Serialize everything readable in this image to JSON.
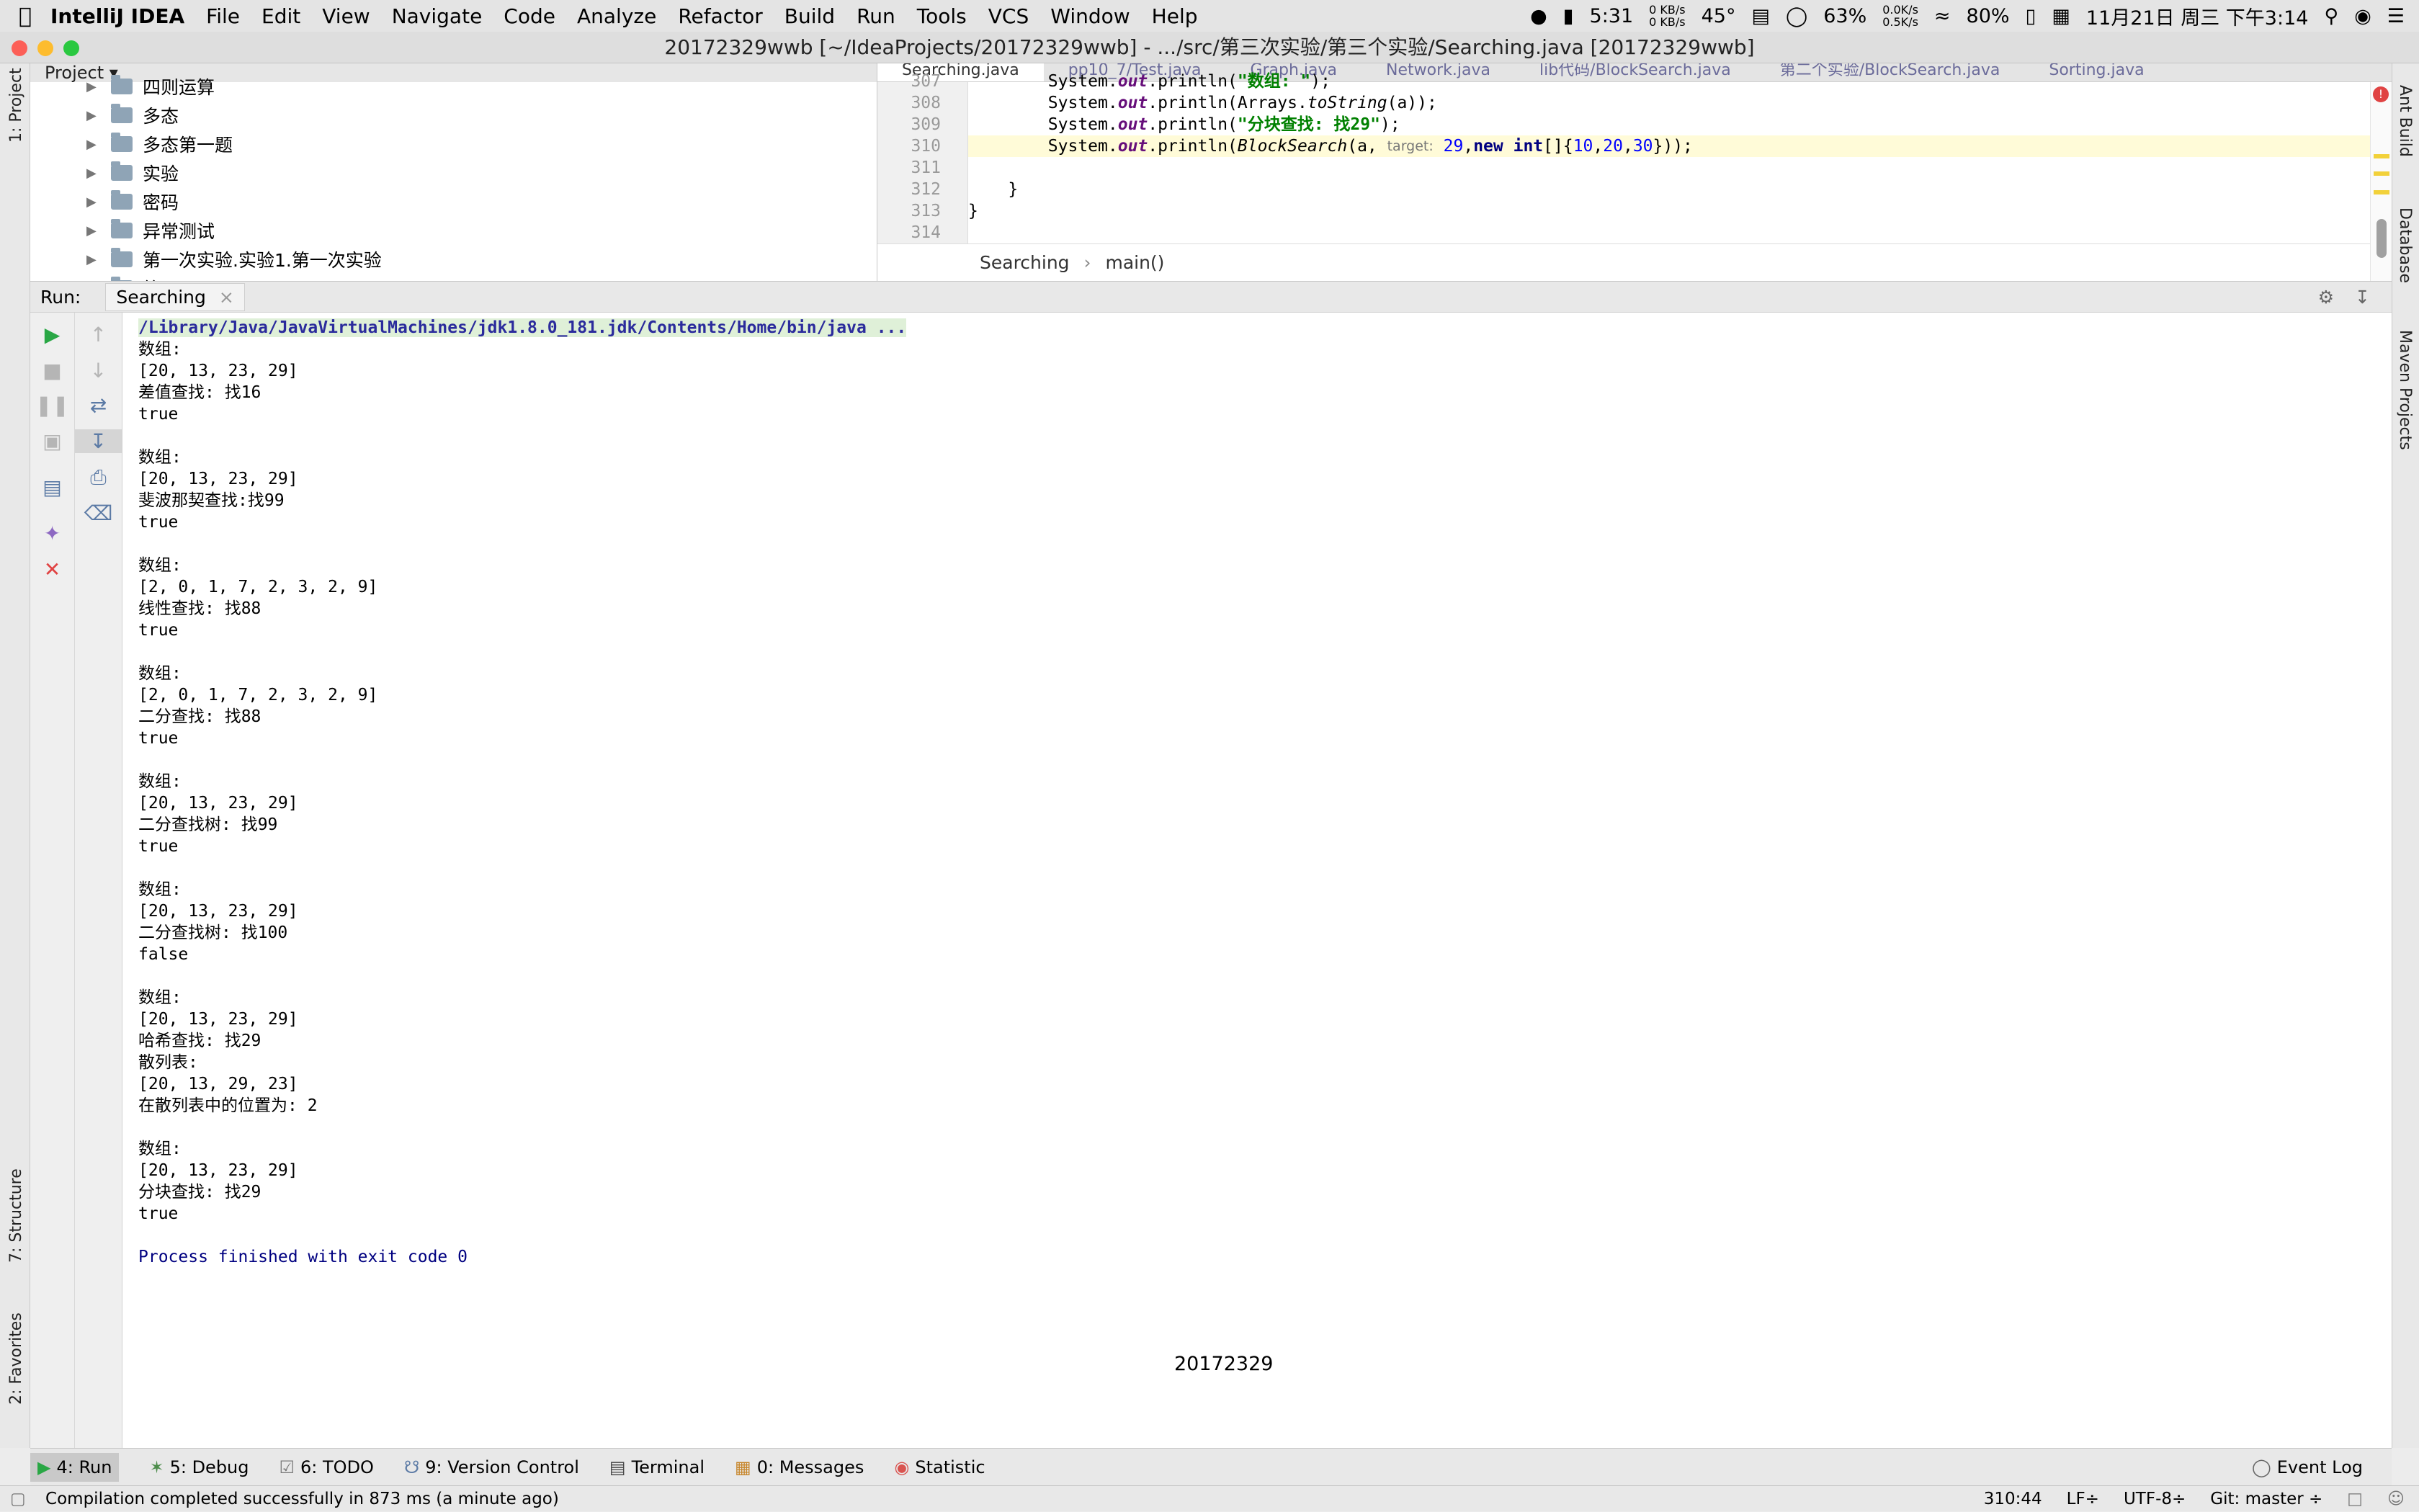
{
  "menubar": {
    "app_name": "IntelliJ IDEA",
    "items": [
      "File",
      "Edit",
      "View",
      "Navigate",
      "Code",
      "Analyze",
      "Refactor",
      "Build",
      "Run",
      "Tools",
      "VCS",
      "Window",
      "Help"
    ],
    "time_small": "5:31",
    "net_up": "0 KB/s",
    "net_down": "0 KB/s",
    "temp": "45°",
    "cpu": "63%",
    "speed_up": "0.0K/s",
    "speed_down": "0.5K/s",
    "battery": "80%",
    "datetime": "11月21日 周三 下午3:14"
  },
  "window": {
    "title": "20172329wwb [~/IdeaProjects/20172329wwb] - .../src/第三次实验/第三个实验/Searching.java [20172329wwb]"
  },
  "left_strip": {
    "project_tab": "1: Project",
    "structure_tab": "7: Structure",
    "favorites_tab": "2: Favorites"
  },
  "right_strip": {
    "ant_tab": "Ant Build",
    "database_tab": "Database",
    "maven_tab": "Maven Projects"
  },
  "project": {
    "header": "Project",
    "items": [
      "四则运算",
      "多态",
      "多态第一题",
      "实验",
      "密码",
      "异常测试",
      "第一次实验.实验1.第一次实验",
      "第一题"
    ]
  },
  "editor": {
    "tabs": [
      "Searching.java",
      "pp10_7/Test.java",
      "Graph.java",
      "Network.java",
      "lib代码/BlockSearch.java",
      "第二个实验/BlockSearch.java",
      "Sorting.java"
    ],
    "line_numbers": [
      "307",
      "308",
      "309",
      "310",
      "311",
      "312",
      "313",
      "314"
    ],
    "code": {
      "l307_pre": "        System.",
      "l307_field": "out",
      "l307_mid": ".println(",
      "l307_str": "\"数组: \"",
      "l307_end": ");",
      "l308_pre": "        System.",
      "l308_field": "out",
      "l308_mid": ".println(Arrays.",
      "l308_it": "toString",
      "l308_end": "(a));",
      "l309_pre": "        System.",
      "l309_field": "out",
      "l309_mid": ".println(",
      "l309_str": "\"分块查找: 找29\"",
      "l309_end": ");",
      "l310_pre": "        System.",
      "l310_field": "out",
      "l310_mid": ".println(",
      "l310_it": "BlockSearch",
      "l310_a": "(a, ",
      "l310_hint": "target:",
      "l310_num1": " 29",
      "l310_c": ",",
      "l310_kw1": "new",
      "l310_sp": " ",
      "l310_kw2": "int",
      "l310_d": "[]{",
      "l310_n10": "10",
      "l310_e": ",",
      "l310_n20": "20",
      "l310_f": ",",
      "l310_n30": "30",
      "l310_g": "}));",
      "l312": "    }",
      "l313": "}"
    },
    "breadcrumb_class": "Searching",
    "breadcrumb_sep": "›",
    "breadcrumb_method": "main()"
  },
  "run": {
    "label": "Run:",
    "tab_name": "Searching"
  },
  "console": {
    "command": "/Library/Java/JavaVirtualMachines/jdk1.8.0_181.jdk/Contents/Home/bin/java ...",
    "lines": [
      "数组:",
      "[20, 13, 23, 29]",
      "差值查找: 找16",
      "true",
      "",
      "数组:",
      "[20, 13, 23, 29]",
      "斐波那契查找:找99",
      "true",
      "",
      "数组:",
      "[2, 0, 1, 7, 2, 3, 2, 9]",
      "线性查找: 找88",
      "true",
      "",
      "数组:",
      "[2, 0, 1, 7, 2, 3, 2, 9]",
      "二分查找: 找88",
      "true",
      "",
      "数组:",
      "[20, 13, 23, 29]",
      "二分查找树: 找99",
      "true",
      "",
      "数组:",
      "[20, 13, 23, 29]",
      "二分查找树: 找100",
      "false",
      "",
      "数组:",
      "[20, 13, 23, 29]",
      "哈希查找: 找29",
      "散列表:",
      "[20, 13, 29, 23]",
      "在散列表中的位置为: 2",
      "",
      "数组:",
      "[20, 13, 23, 29]",
      "分块查找: 找29",
      "true",
      ""
    ],
    "exit_message": "Process finished with exit code 0",
    "watermark": "20172329"
  },
  "bottom_tabs": {
    "run": "4: Run",
    "debug": "5: Debug",
    "todo": "6: TODO",
    "vcs": "9: Version Control",
    "terminal": "Terminal",
    "messages": "0: Messages",
    "statistic": "Statistic",
    "event_log": "Event Log"
  },
  "status": {
    "message": "Compilation completed successfully in 873 ms (a minute ago)",
    "position": "310:44",
    "line_sep": "LF÷",
    "encoding": "UTF-8÷",
    "git": "Git: master ÷"
  },
  "colors": {
    "run_green": "#29a745",
    "stop_red": "#e04343",
    "keyword": "#000080",
    "string": "#008000",
    "number": "#0000ff"
  }
}
